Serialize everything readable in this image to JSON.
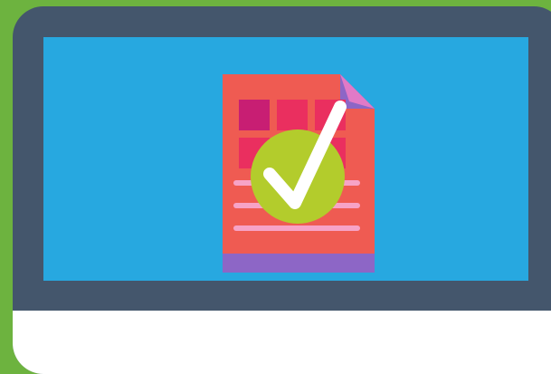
{
  "scene": {
    "icon_names": [
      "monitor-icon",
      "document-icon",
      "checkmark-icon"
    ]
  },
  "colors": {
    "background": "#6db33f",
    "monitor_bezel": "#44566c",
    "screen": "#27a8e0",
    "monitor_chin": "#ffffff",
    "document": "#ef5b52",
    "document_fold": "#8d66c6",
    "document_fold_light": "#f07ec7",
    "document_footer": "#8d66c6",
    "document_line": "#f7a3c6",
    "tile_dark": "#c81e73",
    "tile_mid": "#ea2f5f",
    "tile_light": "#f05a5a",
    "check_badge": "#b3cc2c",
    "check_mark": "#ffffff"
  }
}
